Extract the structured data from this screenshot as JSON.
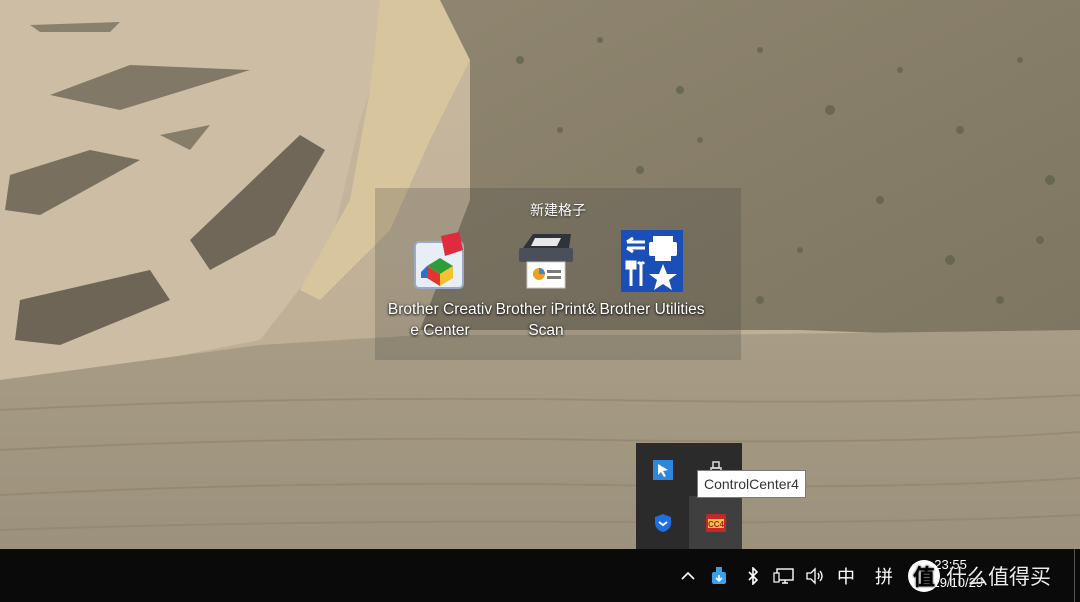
{
  "fence": {
    "title": "新建格子",
    "icons": [
      {
        "label": "Brother Creative Center",
        "icon": "brother-creative-center-icon"
      },
      {
        "label": "Brother iPrint&Scan",
        "icon": "scanner-icon"
      },
      {
        "label": "Brother Utilities",
        "icon": "brother-utilities-icon"
      }
    ]
  },
  "tray_overflow": {
    "icons": [
      "cursor-app-icon",
      "usb-device-icon",
      "shield-icon",
      "controlcenter4-icon"
    ],
    "hovered": "ControlCenter4",
    "tooltip": "ControlCenter4"
  },
  "taskbar": {
    "ime_chinese": "中",
    "ime_layout": "拼",
    "time": "23:55",
    "date": "2019/10/29",
    "watermark_logo": "值",
    "watermark_text": "什么值得买"
  },
  "colors": {
    "taskbar": "#0a0a0a",
    "tray_panel": "#2b2b2b",
    "brother_blue": "#1a4fb8"
  }
}
